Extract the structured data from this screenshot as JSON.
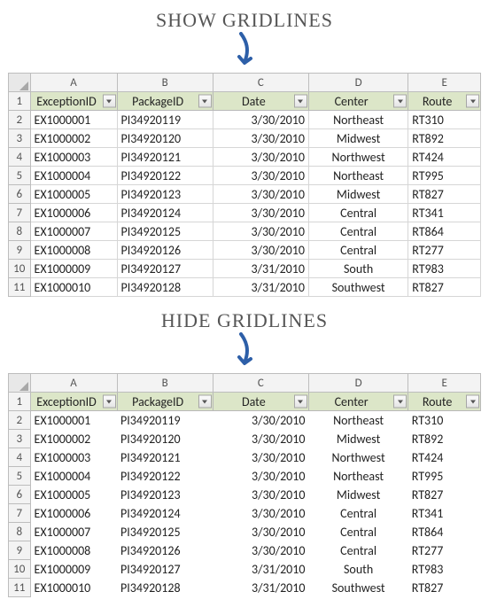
{
  "titles": {
    "show": "SHOW GRIDLINES",
    "hide": "HIDE GRIDLINES"
  },
  "columns": [
    "A",
    "B",
    "C",
    "D",
    "E"
  ],
  "row_numbers": [
    1,
    2,
    3,
    4,
    5,
    6,
    7,
    8,
    9,
    10,
    11
  ],
  "headers": {
    "exception": "ExceptionID",
    "package": "PackageID",
    "date": "Date",
    "center": "Center",
    "route": "Route"
  },
  "rows": [
    {
      "exception": "EX1000001",
      "package": "PI34920119",
      "date": "3/30/2010",
      "center": "Northeast",
      "route": "RT310"
    },
    {
      "exception": "EX1000002",
      "package": "PI34920120",
      "date": "3/30/2010",
      "center": "Midwest",
      "route": "RT892"
    },
    {
      "exception": "EX1000003",
      "package": "PI34920121",
      "date": "3/30/2010",
      "center": "Northwest",
      "route": "RT424"
    },
    {
      "exception": "EX1000004",
      "package": "PI34920122",
      "date": "3/30/2010",
      "center": "Northeast",
      "route": "RT995"
    },
    {
      "exception": "EX1000005",
      "package": "PI34920123",
      "date": "3/30/2010",
      "center": "Midwest",
      "route": "RT827"
    },
    {
      "exception": "EX1000006",
      "package": "PI34920124",
      "date": "3/30/2010",
      "center": "Central",
      "route": "RT341"
    },
    {
      "exception": "EX1000007",
      "package": "PI34920125",
      "date": "3/30/2010",
      "center": "Central",
      "route": "RT864"
    },
    {
      "exception": "EX1000008",
      "package": "PI34920126",
      "date": "3/30/2010",
      "center": "Central",
      "route": "RT277"
    },
    {
      "exception": "EX1000009",
      "package": "PI34920127",
      "date": "3/31/2010",
      "center": "South",
      "route": "RT983"
    },
    {
      "exception": "EX1000010",
      "package": "PI34920128",
      "date": "3/31/2010",
      "center": "Southwest",
      "route": "RT827"
    }
  ],
  "arrow_color": "#2d5fa8"
}
